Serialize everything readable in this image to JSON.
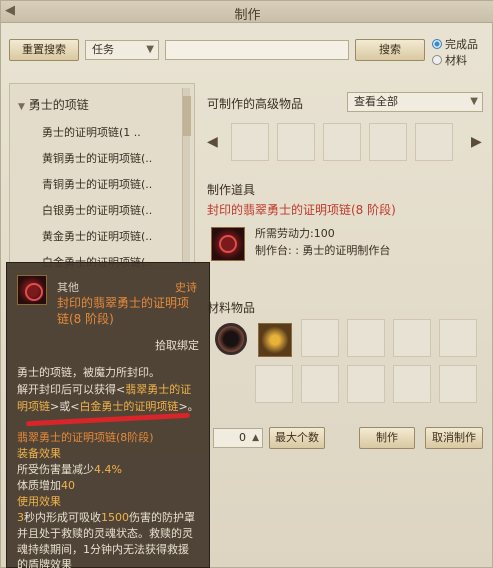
{
  "window": {
    "title": "制作",
    "back_icon": "chevron-left-icon"
  },
  "toolbar": {
    "reset_search_label": "重置搜索",
    "category_select_value": "任务",
    "search_input_value": "",
    "search_button_label": "搜索",
    "radio_complete_label": "完成品",
    "radio_material_label": "材料"
  },
  "tree": {
    "header": "勇士的项链",
    "items": [
      "勇士的证明项链(1 ..",
      "黄铜勇士的证明项链(..",
      "青铜勇士的证明项链(..",
      "白银勇士的证明项链(..",
      "黄金勇士的证明项链(..",
      "白金勇士的证明项链(.."
    ]
  },
  "craftable": {
    "label": "可制作的高级物品",
    "filter_value": "查看全部"
  },
  "tool": {
    "section_label": "制作道具",
    "item_name": "封印的翡翠勇士的证明项链(8 阶段)",
    "required_effort": "所需劳动力:100",
    "craft_station": "制作台: : 勇士的证明制作台"
  },
  "materials": {
    "section_label": "材料物品"
  },
  "bottom": {
    "quantity": "0",
    "max_label": "最大个数",
    "craft_label": "制作",
    "cancel_label": "取消制作"
  },
  "tooltip": {
    "category": "其他",
    "rarity": "史诗",
    "name_line1": "封印的翡翠勇士的证明项",
    "name_line2": "链(8 阶段)",
    "bind": "拾取绑定",
    "desc1": "勇士的项链，被魔力所封印。",
    "desc2a": "解开封印后可以获得<",
    "desc2b": "翡翠勇士的证",
    "desc3a": "明项链",
    "desc3b": ">或<",
    "desc3c": "白金勇士的证明项链",
    "desc3d": ">。",
    "result_name": "翡翠勇士的证明项链(8阶段)",
    "equip_effect_label": "装备效果",
    "dmg_reduction_a": "所受伤害量减少",
    "dmg_reduction_b": "4.4%",
    "stamina_a": "体质增加",
    "stamina_b": "40",
    "use_effect_label": "使用效果",
    "use1a": "3",
    "use1b": "秒内形成可吸收",
    "use1c": "1500",
    "use1d": "伤害的防护罩",
    "use2": "并且处于救赎的灵魂状态。救赎的灵",
    "use3": "魂持续期间，1分钟内无法获得救援",
    "use4": "的盾牌效果"
  },
  "colors": {
    "accent_red": "#c0392b",
    "tooltip_gold": "#f0b34a",
    "tooltip_orange": "#e68a3a"
  }
}
